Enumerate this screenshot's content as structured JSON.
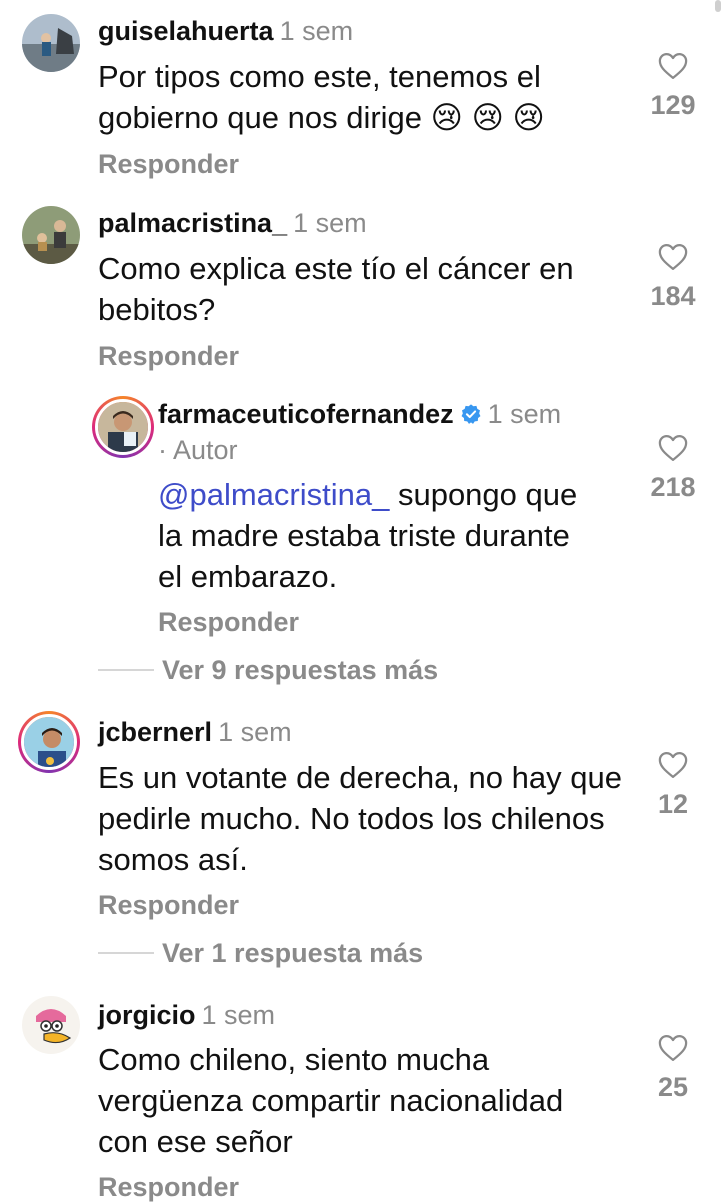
{
  "comments": [
    {
      "username": "guiselahuerta",
      "time": "1 sem",
      "text": "Por tipos como este, tenemos el gobierno que nos dirige",
      "emojis": "😢 😢 😢",
      "likes": "129",
      "reply_label": "Responder"
    },
    {
      "username": "palmacristina_",
      "time": "1 sem",
      "text": "Como explica este tío el cáncer en bebitos?",
      "likes": "184",
      "reply_label": "Responder",
      "replies": [
        {
          "username": "farmaceuticofernandez",
          "verified": true,
          "time": "1 sem",
          "author_tag": "· Autor",
          "mention": "@palmacristina_",
          "text": " supongo que la madre estaba triste durante el embarazo.",
          "likes": "218",
          "reply_label": "Responder"
        }
      ],
      "view_more_label": "Ver 9 respuestas más"
    },
    {
      "username": "jcbernerl",
      "time": "1 sem",
      "text": "Es un votante de derecha, no hay que pedirle mucho. No todos los chilenos somos así.",
      "likes": "12",
      "reply_label": "Responder",
      "view_more_label": "Ver 1 respuesta más"
    },
    {
      "username": "jorgicio",
      "time": "1 sem",
      "text": "Como chileno, siento mucha vergüenza compartir nacionalidad con ese señor",
      "likes": "25",
      "reply_label": "Responder"
    }
  ],
  "colors": {
    "username": "#111111",
    "secondary": "#8a8a8a",
    "mention": "#3e4cc9",
    "verified": "#3897f0"
  },
  "icons": {
    "like": "heart-outline-icon",
    "verified": "verified-badge-icon"
  }
}
